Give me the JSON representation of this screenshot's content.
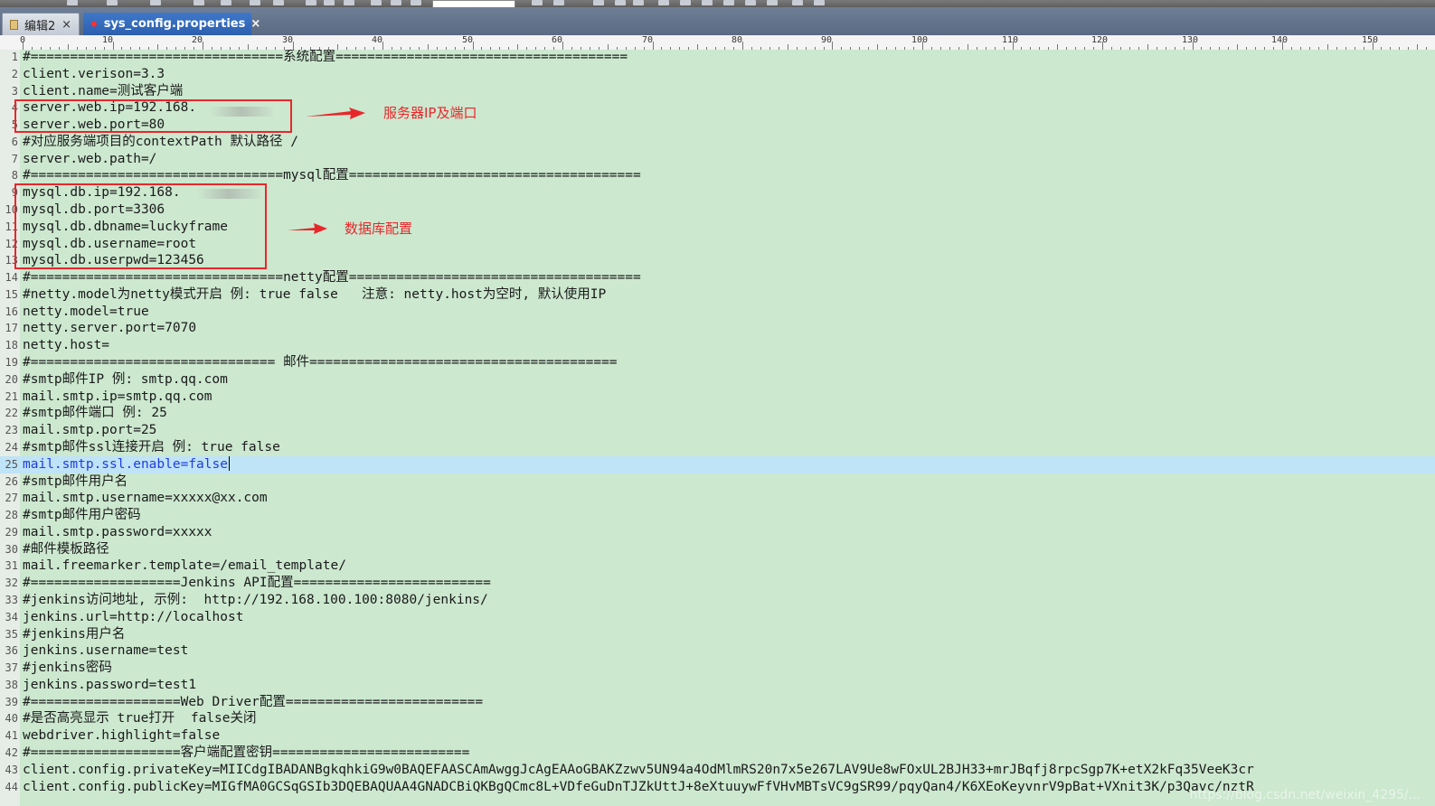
{
  "tabs": [
    {
      "label": "编辑2",
      "close": "×",
      "active": false
    },
    {
      "label": "sys_config.properties",
      "close": "×",
      "active": true
    }
  ],
  "ruler": {
    "labels": [
      "0",
      "10",
      "20",
      "30",
      "40",
      "50",
      "60",
      "70",
      "80",
      "90",
      "100",
      "110",
      "120",
      "130",
      "140",
      "150"
    ]
  },
  "editor": {
    "current_line": 25,
    "lines": [
      "#================================系统配置=====================================",
      "client.verison=3.3",
      "client.name=测试客户端",
      "server.web.ip=192.168.",
      "server.web.port=80",
      "#对应服务端项目的contextPath 默认路径 /",
      "server.web.path=/",
      "#================================mysql配置=====================================",
      "mysql.db.ip=192.168.",
      "mysql.db.port=3306",
      "mysql.db.dbname=luckyframe",
      "mysql.db.username=root",
      "mysql.db.userpwd=123456",
      "#================================netty配置=====================================",
      "#netty.model为netty模式开启 例: true false   注意: netty.host为空时, 默认使用IP",
      "netty.model=true",
      "netty.server.port=7070",
      "netty.host=",
      "#=============================== 邮件=======================================",
      "#smtp邮件IP 例: smtp.qq.com",
      "mail.smtp.ip=smtp.qq.com",
      "#smtp邮件端口 例: 25",
      "mail.smtp.port=25",
      "#smtp邮件ssl连接开启 例: true false",
      "mail.smtp.ssl.enable=false",
      "#smtp邮件用户名",
      "mail.smtp.username=xxxxx@xx.com",
      "#smtp邮件用户密码",
      "mail.smtp.password=xxxxx",
      "#邮件模板路径",
      "mail.freemarker.template=/email_template/",
      "#===================Jenkins API配置=========================",
      "#jenkins访问地址, 示例:  http://192.168.100.100:8080/jenkins/",
      "jenkins.url=http://localhost",
      "#jenkins用户名",
      "jenkins.username=test",
      "#jenkins密码",
      "jenkins.password=test1",
      "#===================Web Driver配置=========================",
      "#是否高亮显示 true打开  false关闭",
      "webdriver.highlight=false",
      "#===================客户端配置密钥=========================",
      "client.config.privateKey=MIICdgIBADANBgkqhkiG9w0BAQEFAASCAmAwggJcAgEAAoGBAKZzwv5UN94a4OdMlmRS20n7x5e267LAV9Ue8wFOxUL2BJH33+mrJBqfj8rpcSgp7K+etX2kFq35VeeK3cr",
      "client.config.publicKey=MIGfMA0GCSqGSIb3DQEBAQUAA4GNADCBiQKBgQCmc8L+VDfeGuDnTJZkUttJ+8eXtuuywFfVHvMBTsVC9gSR99/pqyQan4/K6XEoKeyvnrV9pBat+VXnit3K/p3Qavc/nztR"
    ]
  },
  "annotations": {
    "server_label": "服务器IP及端口",
    "db_label": "数据库配置",
    "color": "#e8272b"
  },
  "watermark": "https://blog.csdn.net/weixin_4295/..."
}
